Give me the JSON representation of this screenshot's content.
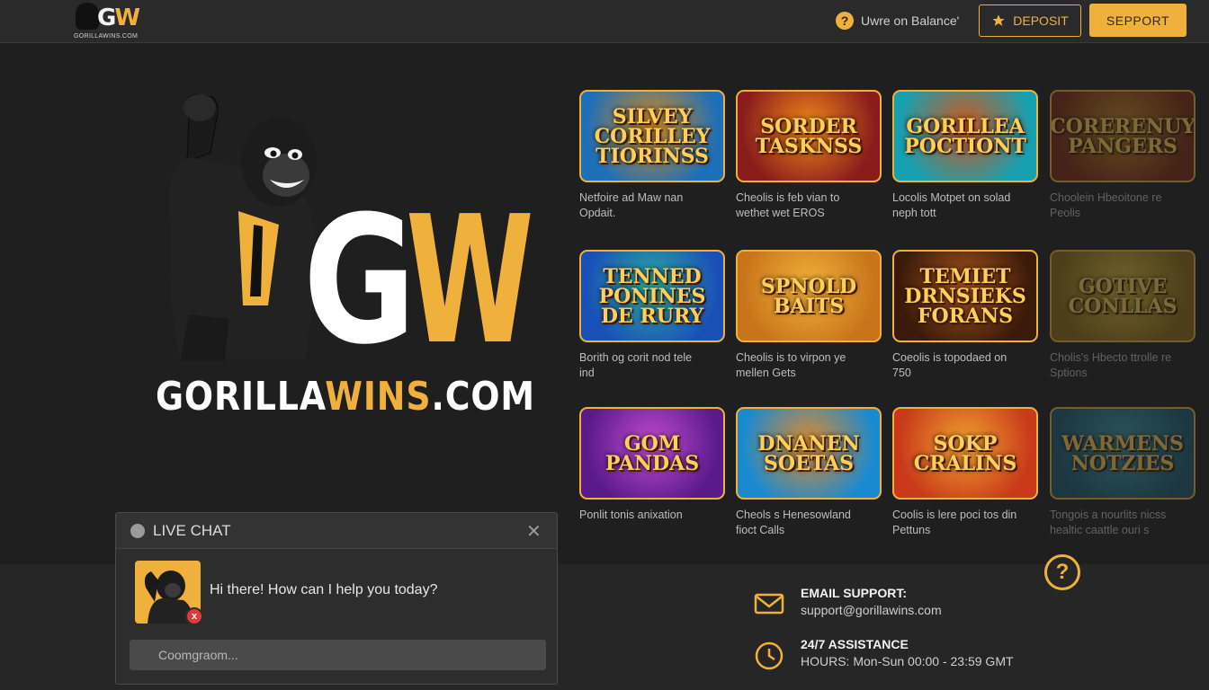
{
  "header": {
    "logo_mark_g": "G",
    "logo_mark_w": "W",
    "logo_url": "GORILLAWINS.COM",
    "balance_help_icon": "?",
    "balance_text": "Uwre on Balance'",
    "deposit_label": "DEPOSIT",
    "deposit_icon": "star-icon",
    "support_label": "SEPPORT"
  },
  "hero": {
    "mark_g": "G",
    "mark_w": "W",
    "url_white_1": "GORILLA",
    "url_yellow": "WINS",
    "url_white_2": ".COM"
  },
  "games": [
    {
      "title": "SILVEY\nCORILLEY\nTIORINSS",
      "caption": "Netfoire ad Maw nan\nOpdait.",
      "colors": [
        "#1d6fb8",
        "#d68a1a"
      ]
    },
    {
      "title": "SORDER\nTASKNSS",
      "caption": "Cheolis is feb vian to\nwethet wet EROS",
      "colors": [
        "#8a1c1c",
        "#f08a1a"
      ]
    },
    {
      "title": "GORILLEA\nPOCTIONT",
      "caption": "Locolis Motpet on solad\nneph tott",
      "colors": [
        "#16a0b0",
        "#d4561a"
      ]
    },
    {
      "title": "CORERENUY\nPANGERS",
      "caption": "Choolein Hbeoitone re\nPeolis",
      "colors": [
        "#7a2a10",
        "#c98a20"
      ]
    },
    {
      "title": "TENNED\nPONINES\nDE RURY",
      "caption": "Borith og corit nod tele\nind",
      "colors": [
        "#1a4fb8",
        "#2bb0a0"
      ]
    },
    {
      "title": "SPNOLD\nBAITS",
      "caption": "Cheolis is to virpon ye\nmellen Gets",
      "colors": [
        "#c8741a",
        "#f2b23a"
      ]
    },
    {
      "title": "TEMIET\nDRNSIEKS\nFORANS",
      "caption": "Coeolis is topodaed on\n750",
      "colors": [
        "#3a1a0a",
        "#a8541a"
      ]
    },
    {
      "title": "GOTIVE\nCONLLAS",
      "caption": "Cholis's Hbecto ttrolle re\nSptions",
      "colors": [
        "#8a6a10",
        "#e0c040"
      ]
    },
    {
      "title": "GOM\nPANDAS",
      "caption": "Ponlit tonis anixation",
      "colors": [
        "#5a1a8a",
        "#c04ad0"
      ]
    },
    {
      "title": "DNANEN\nSOETAS",
      "caption": "Cheols s Henesowland\nfioct Calls",
      "colors": [
        "#1a8ad0",
        "#e08a2a"
      ]
    },
    {
      "title": "SOKP\nCRALINS",
      "caption": "Coolis is lere poci tos din\nPettuns",
      "colors": [
        "#c83a1a",
        "#f0a030"
      ]
    },
    {
      "title": "WARMENS\nNOTZIES",
      "caption": "Tongois a nourlits nicss\nhealtic caattle ouri s",
      "colors": [
        "#1a5a70",
        "#3aa0b0"
      ]
    }
  ],
  "chat": {
    "title": "LIVE CHAT",
    "close_icon": "close-icon",
    "message": "Hi there! How can I help you today?",
    "badge": "x",
    "input_placeholder": "Coomgraom..."
  },
  "contact": {
    "email_label": "EMAIL SUPPORT:",
    "email_value": "support@gorillawins.com",
    "hours_label": "24/7 ASSISTANCE",
    "hours_value": "HOURS: Mon-Sun 00:00 - 23:59 GMT",
    "help_icon": "?"
  },
  "colors": {
    "accent": "#f0b13c",
    "background": "#1f1f1f",
    "header": "#2a2a2a"
  }
}
